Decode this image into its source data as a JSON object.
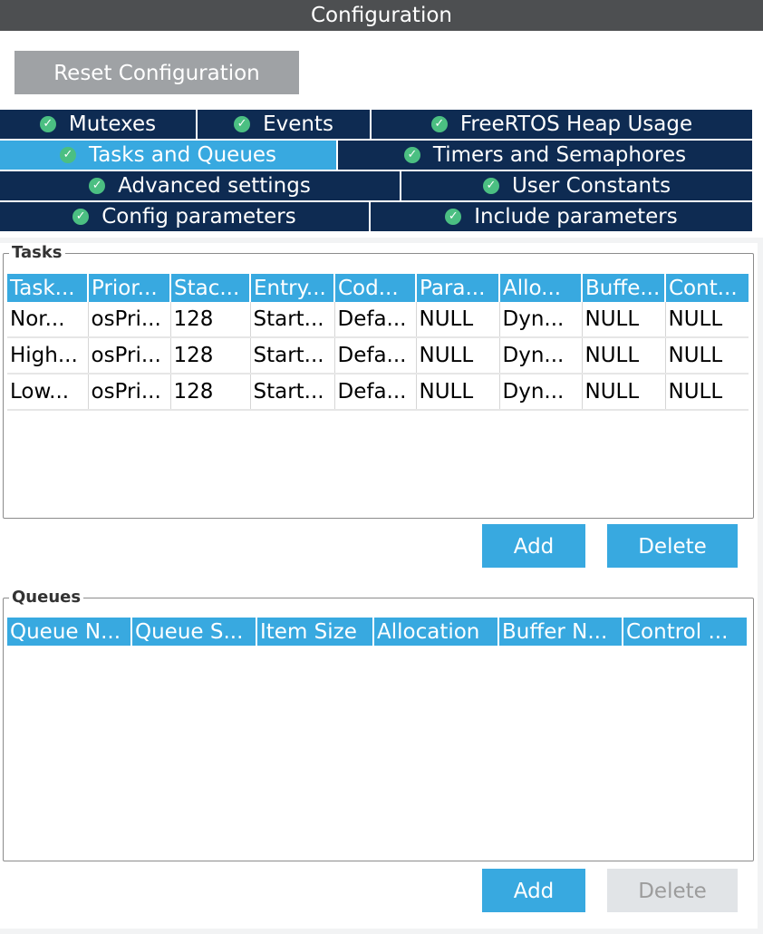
{
  "window": {
    "title": "Configuration"
  },
  "toolbar": {
    "reset_label": "Reset Configuration"
  },
  "tabs": {
    "rows": [
      [
        {
          "label": "Mutexes",
          "active": false
        },
        {
          "label": "Events",
          "active": false
        },
        {
          "label": "FreeRTOS Heap Usage",
          "active": false
        }
      ],
      [
        {
          "label": "Tasks and Queues",
          "active": true
        },
        {
          "label": "Timers and Semaphores",
          "active": false
        }
      ],
      [
        {
          "label": "Advanced settings",
          "active": false
        },
        {
          "label": "User Constants",
          "active": false
        }
      ],
      [
        {
          "label": "Config parameters",
          "active": false
        },
        {
          "label": "Include parameters",
          "active": false
        }
      ]
    ]
  },
  "tasks": {
    "legend": "Tasks",
    "columns": [
      "Task...",
      "Prior...",
      "Stac...",
      "Entry...",
      "Cod...",
      "Para...",
      "Allo...",
      "Buffe...",
      "Cont..."
    ],
    "rows": [
      [
        "Nor...",
        "osPri...",
        "128",
        "Start...",
        "Defa...",
        "NULL",
        "Dyn...",
        "NULL",
        "NULL"
      ],
      [
        "High...",
        "osPri...",
        "128",
        "Start...",
        "Defa...",
        "NULL",
        "Dyn...",
        "NULL",
        "NULL"
      ],
      [
        "Low...",
        "osPri...",
        "128",
        "Start...",
        "Defa...",
        "NULL",
        "Dyn...",
        "NULL",
        "NULL"
      ]
    ],
    "add_label": "Add",
    "delete_label": "Delete"
  },
  "queues": {
    "legend": "Queues",
    "columns": [
      "Queue N...",
      "Queue S...",
      "Item Size",
      "Allocation",
      "Buffer N...",
      "Control ..."
    ],
    "rows": [],
    "add_label": "Add",
    "delete_label": "Delete",
    "delete_enabled": false
  },
  "colors": {
    "titlebar": "#4d4f51",
    "tab_inactive": "#0e2b52",
    "tab_active": "#38a9e0",
    "header_blue": "#38a9e0",
    "check_green": "#4bbf82",
    "button_disabled": "#e1e4e7"
  },
  "icons": {
    "tab_status": "check-circle-icon"
  }
}
